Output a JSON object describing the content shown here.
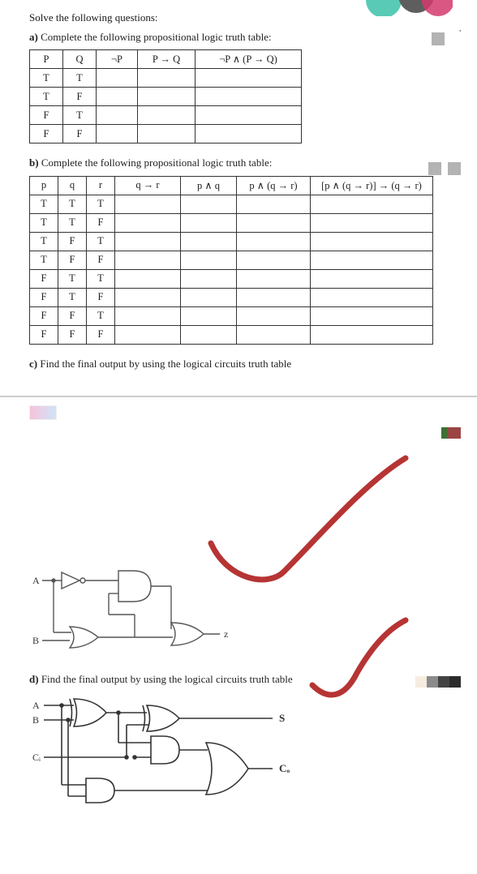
{
  "heading": "Solve the following questions:",
  "a": {
    "label": "a)",
    "text": "Complete the following propositional logic truth table:",
    "headers": [
      "P",
      "Q",
      "¬P",
      "P → Q",
      "¬P ∧ (P → Q)"
    ],
    "rows": [
      [
        "T",
        "T",
        "",
        "",
        ""
      ],
      [
        "T",
        "F",
        "",
        "",
        ""
      ],
      [
        "F",
        "T",
        "",
        "",
        ""
      ],
      [
        "F",
        "F",
        "",
        "",
        ""
      ]
    ]
  },
  "b": {
    "label": "b)",
    "text": "Complete the following propositional logic truth table:",
    "headers": [
      "p",
      "q",
      "r",
      "q → r",
      "p ∧ q",
      "p ∧ (q → r)",
      "[p ∧ (q → r)] → (q → r)"
    ],
    "rows": [
      [
        "T",
        "T",
        "T",
        "",
        "",
        "",
        ""
      ],
      [
        "T",
        "T",
        "F",
        "",
        "",
        "",
        ""
      ],
      [
        "T",
        "F",
        "T",
        "",
        "",
        "",
        ""
      ],
      [
        "T",
        "F",
        "F",
        "",
        "",
        "",
        ""
      ],
      [
        "F",
        "T",
        "T",
        "",
        "",
        "",
        ""
      ],
      [
        "F",
        "T",
        "F",
        "",
        "",
        "",
        ""
      ],
      [
        "F",
        "F",
        "T",
        "",
        "",
        "",
        ""
      ],
      [
        "F",
        "F",
        "F",
        "",
        "",
        "",
        ""
      ]
    ]
  },
  "c": {
    "label": "c)",
    "text": "Find the final output by using the logical circuits truth table",
    "inputs": [
      "A",
      "B"
    ],
    "output": "z"
  },
  "d": {
    "label": "d)",
    "text": "Find the final output by using the logical circuits truth table",
    "inputs": [
      "A",
      "B",
      "Cᵢ"
    ],
    "outputs": [
      "S",
      "Cₒ"
    ]
  }
}
